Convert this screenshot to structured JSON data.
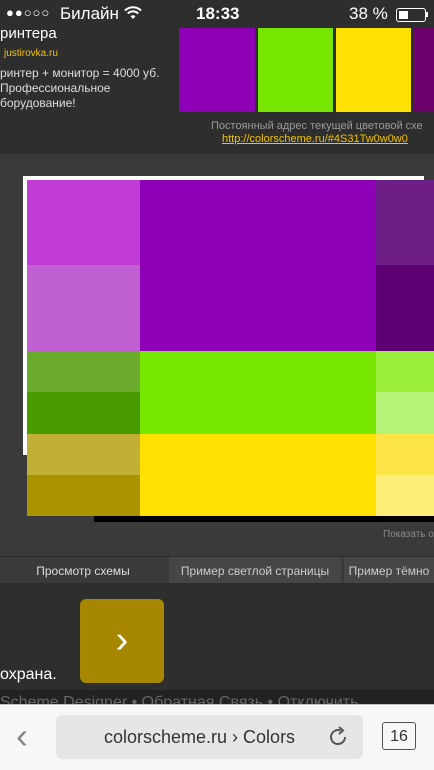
{
  "status_bar": {
    "signal": "●●○○○",
    "carrier": "Билайн",
    "time": "18:33",
    "battery_pct": "38 %",
    "battery_level": 0.38
  },
  "ad": {
    "title": "ринтера",
    "domain": "justirovka.ru",
    "body": "ринтер + монитор = 4000 уб. Профессиональное борудование!"
  },
  "swatch_strip": [
    "#8e00b5",
    "#77e600",
    "#ffe100",
    "#6b006b"
  ],
  "permalink": {
    "label": "Постоянный адрес текущей цветовой схе",
    "url": "http://colorscheme.ru/#4S31Tw0w0w0"
  },
  "preview": {
    "cells": [
      {
        "color": "#c03cd4"
      },
      {
        "color": "#8e00b5"
      },
      {
        "color": "#6c1d86"
      },
      {
        "color": "#c05fd2"
      },
      {
        "color": "#5c0073"
      },
      {
        "color": "#6aaa2c"
      },
      {
        "color": "#77e600"
      },
      {
        "color": "#9af03a"
      },
      {
        "color": "#4a9b00"
      },
      {
        "color": "#b4f376"
      },
      {
        "color": "#c0b036"
      },
      {
        "color": "#ffe100"
      },
      {
        "color": "#fde547"
      },
      {
        "color": "#aa9400"
      },
      {
        "color": "#fdee78"
      }
    ],
    "show_link": "Показать о"
  },
  "tabs": [
    {
      "label": "Просмотр схемы"
    },
    {
      "label": "Пример светлой страницы"
    },
    {
      "label": "Пример тёмно"
    }
  ],
  "lower": {
    "next_symbol": "›",
    "text": "охрана.",
    "footer_links": "Scheme Designer  •  Обратная Связь  •  Отключить"
  },
  "safari": {
    "back_symbol": "‹",
    "url": "colorscheme.ru › Colors",
    "tab_count": "16"
  }
}
